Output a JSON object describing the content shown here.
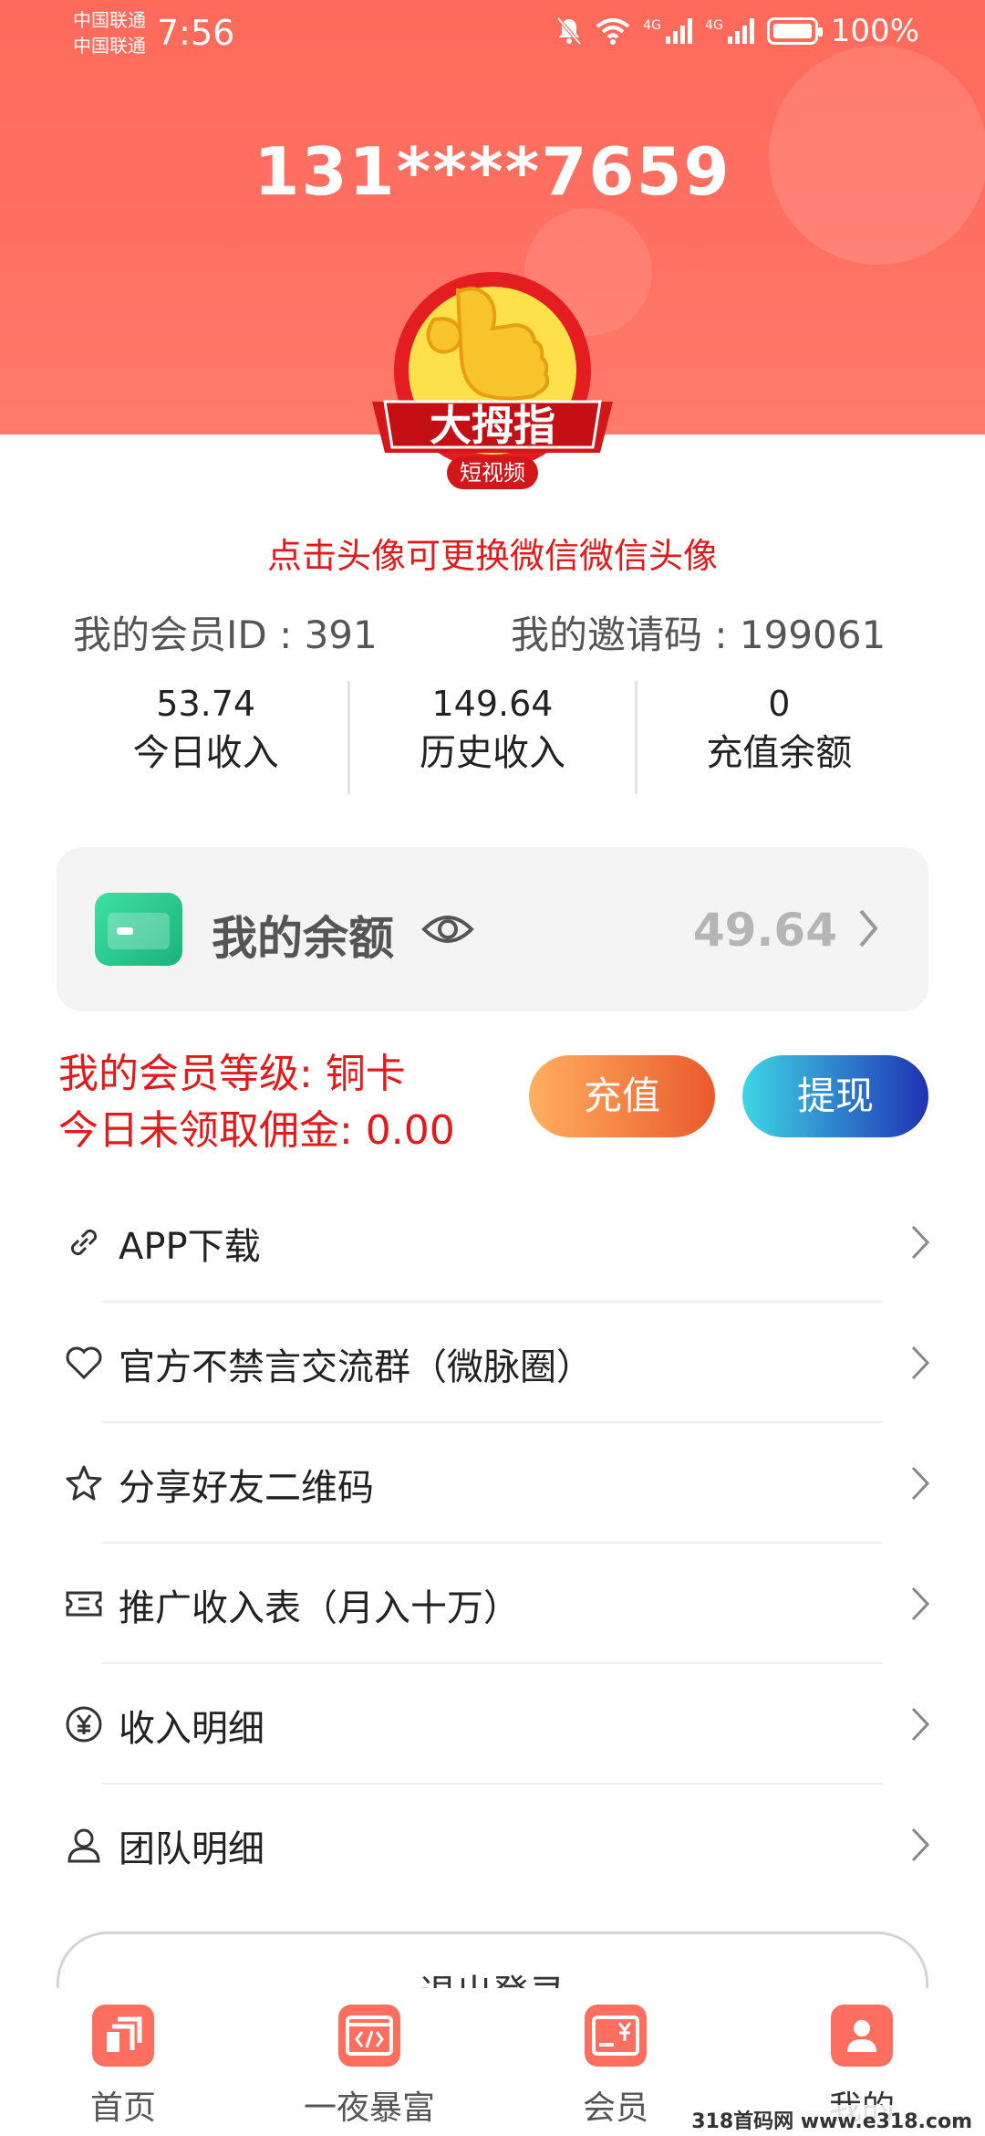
{
  "status_bar": {
    "carrier_1": "中国联通",
    "carrier_2": "中国联通",
    "time": "7:56",
    "network_1": "4G",
    "network_2": "4G",
    "battery": "100%"
  },
  "header": {
    "phone": "131****7659"
  },
  "avatar": {
    "logo_title": "大拇指",
    "logo_subtitle": "短视频",
    "hint": "点击头像可更换微信微信头像"
  },
  "ids": {
    "member_id": "我的会员ID : 391",
    "invite_code": "我的邀请码 : 199061"
  },
  "stats": [
    {
      "value": "53.74",
      "label": "今日收入"
    },
    {
      "value": "149.64",
      "label": "历史收入"
    },
    {
      "value": "0",
      "label": "充值余额"
    }
  ],
  "balance": {
    "label": "我的余额",
    "value": "49.64"
  },
  "member": {
    "level": "我的会员等级: 铜卡",
    "commission": "今日未领取佣金: 0.00",
    "recharge_label": "充值",
    "withdraw_label": "提现"
  },
  "menu": [
    {
      "label": "APP下载",
      "icon": "link-icon"
    },
    {
      "label": "官方不禁言交流群（微脉圈）",
      "icon": "heart-icon"
    },
    {
      "label": "分享好友二维码",
      "icon": "star-icon"
    },
    {
      "label": "推广收入表（月入十万）",
      "icon": "ticket-icon"
    },
    {
      "label": "收入明细",
      "icon": "yuan-circle-icon"
    },
    {
      "label": "团队明细",
      "icon": "user-icon"
    }
  ],
  "logout": {
    "label": "退出登录"
  },
  "tabs": [
    {
      "label": "首页",
      "icon": "home-icon"
    },
    {
      "label": "一夜暴富",
      "icon": "code-icon"
    },
    {
      "label": "会员",
      "icon": "yuan-card-icon"
    },
    {
      "label": "我的",
      "icon": "profile-icon"
    }
  ],
  "watermark": "318首码网 www.e318.com",
  "colors": {
    "header": "#ff6a5a",
    "accent_red": "#e01b1b",
    "wallet_green": "#2ecc8f"
  }
}
